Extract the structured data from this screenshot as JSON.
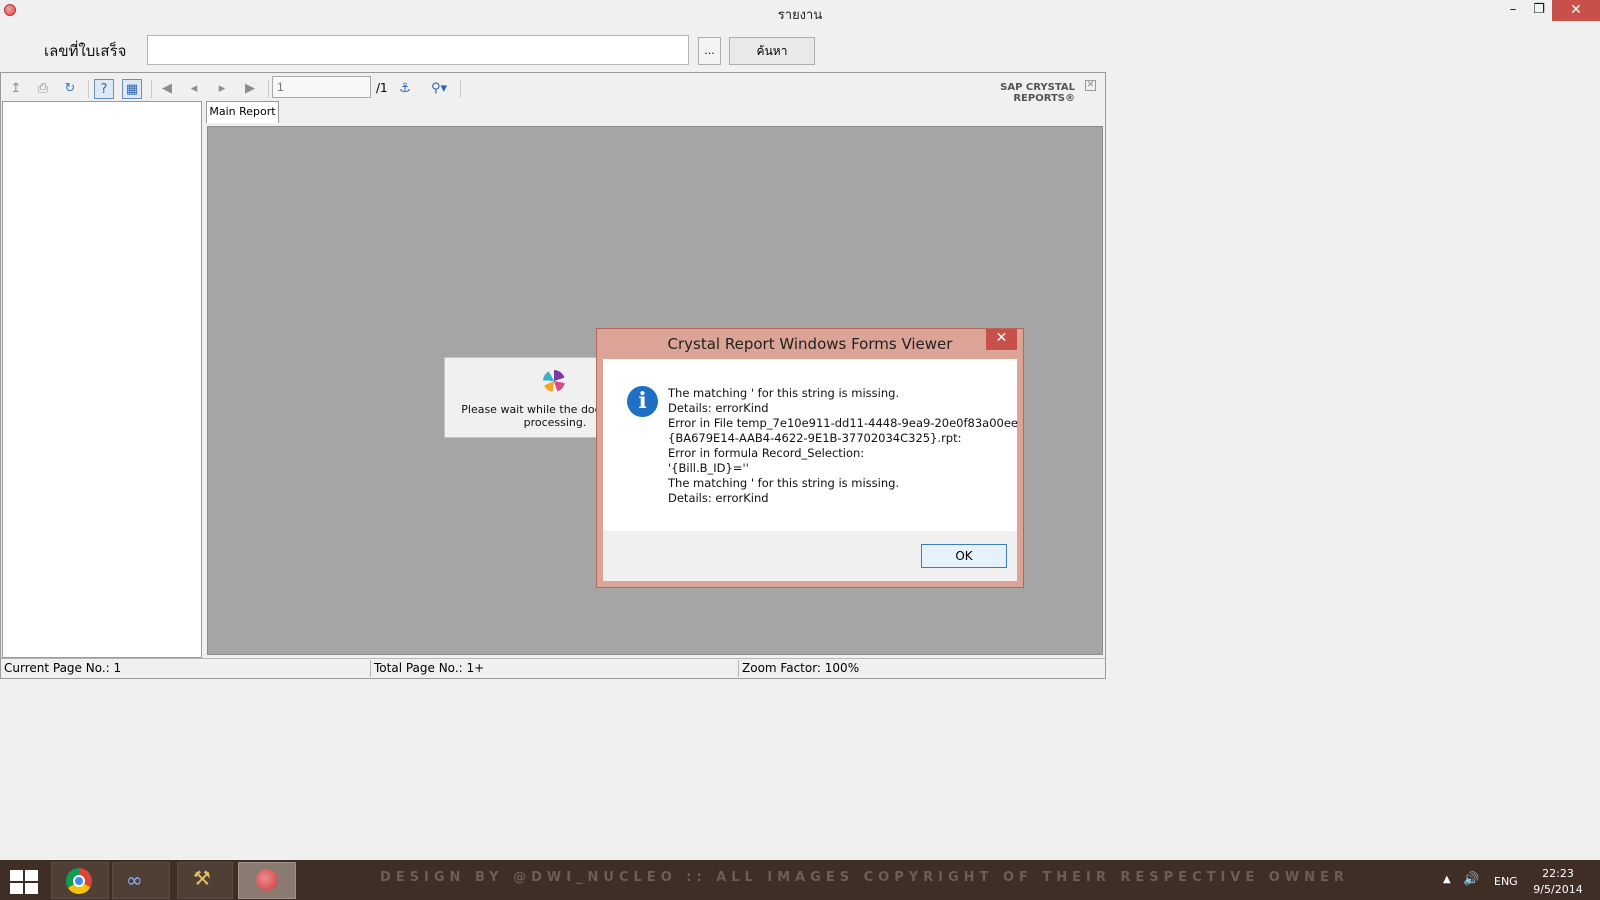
{
  "window": {
    "title": "รายงาน"
  },
  "search": {
    "label": "เลขที่ใบเสร็จ",
    "value": "",
    "browse_label": "...",
    "search_label": "ค้นหา"
  },
  "viewer": {
    "page_input": "1",
    "page_total": "/1",
    "brand": "SAP CRYSTAL REPORTS®",
    "tab_label": "Main Report",
    "wait_message": "Please wait while the document is processing.",
    "status": {
      "current_page": "Current Page No.: 1",
      "total_page": "Total Page No.: 1+",
      "zoom": "Zoom Factor: 100%"
    },
    "toolbar_icons": [
      "export-icon",
      "print-icon",
      "refresh-icon",
      "help-icon",
      "group-tree-icon",
      "first-page-icon",
      "prev-page-icon",
      "next-page-icon",
      "last-page-icon",
      "find-icon",
      "zoom-icon"
    ]
  },
  "dialog": {
    "title": "Crystal Report Windows Forms Viewer",
    "lines": [
      "The matching ' for this string is missing.",
      "Details: errorKind",
      "Error in File temp_7e10e911-dd11-4448-9ea9-20e0f83a00ee",
      "{BA679E14-AAB4-4622-9E1B-37702034C325}.rpt:",
      "Error in formula  Record_Selection:",
      "'{Bill.B_ID}=''",
      "The matching ' for this string is missing.",
      "Details: errorKind"
    ],
    "ok_label": "OK"
  },
  "taskbar": {
    "watermark": "DESIGN BY @DWI_NUCLEO :: ALL IMAGES COPYRIGHT OF THEIR RESPECTIVE OWNER",
    "lang": "ENG",
    "time": "22:23",
    "date": "9/5/2014"
  },
  "colors": {
    "dialog_frame": "#dba496",
    "close_red": "#c7504a",
    "taskbar": "#3e2e25",
    "canvas_gray": "#a5a5a5"
  }
}
